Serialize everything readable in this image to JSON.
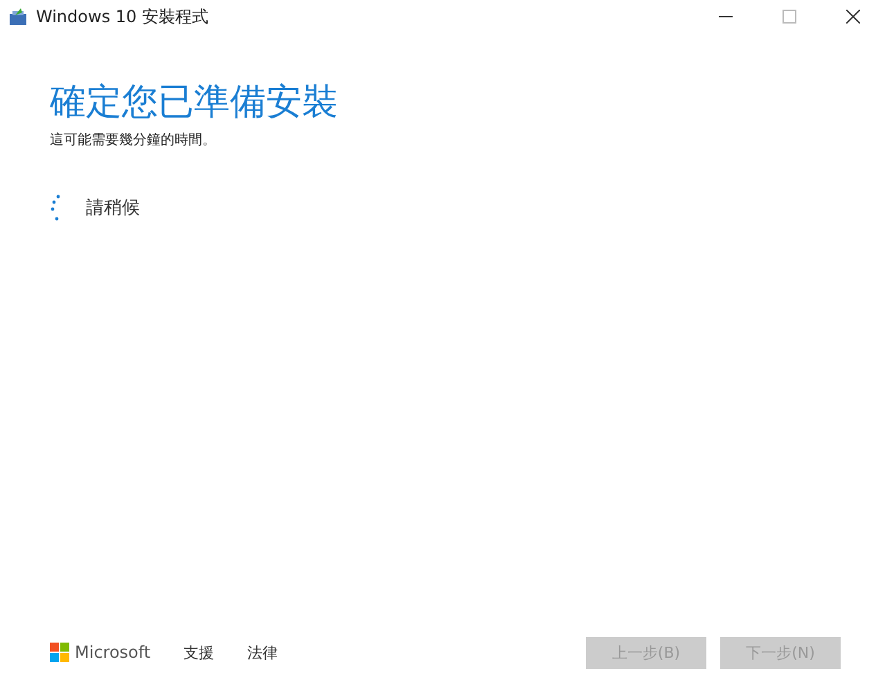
{
  "window": {
    "title": "Windows 10 安裝程式"
  },
  "heading": "確定您已準備安裝",
  "subtitle": "這可能需要幾分鐘的時間。",
  "progress": {
    "label": "請稍候"
  },
  "footer": {
    "brand": "Microsoft",
    "links": [
      "支援",
      "法律"
    ]
  },
  "buttons": [
    {
      "label": "上一步(B)",
      "disabled": true
    },
    {
      "label": "下一步(N)",
      "disabled": true
    }
  ]
}
